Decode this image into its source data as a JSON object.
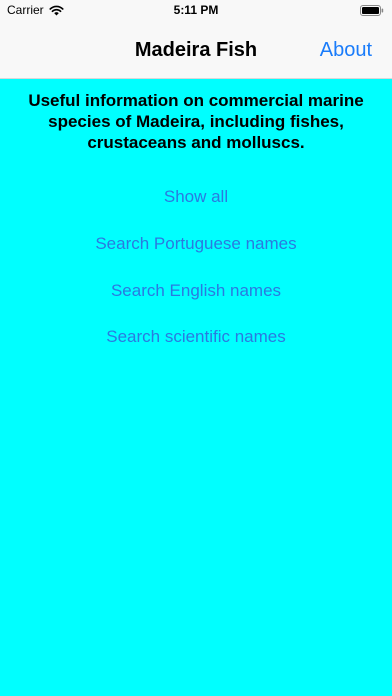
{
  "status_bar": {
    "carrier": "Carrier",
    "time": "5:11 PM",
    "wifi_icon": "wifi-icon",
    "battery_icon": "battery-icon"
  },
  "nav": {
    "title": "Madeira Fish",
    "about_label": "About"
  },
  "main": {
    "intro": "Useful information on commercial marine species of Madeira, including fishes, crustaceans and molluscs.",
    "links": [
      "Show all",
      "Search Portuguese names",
      "Search English names",
      "Search scientific names"
    ]
  },
  "colors": {
    "background": "#00FFFF",
    "nav_background": "#F8F8F8",
    "tint": "#1A7CFA",
    "link": "#2A7AE0"
  }
}
